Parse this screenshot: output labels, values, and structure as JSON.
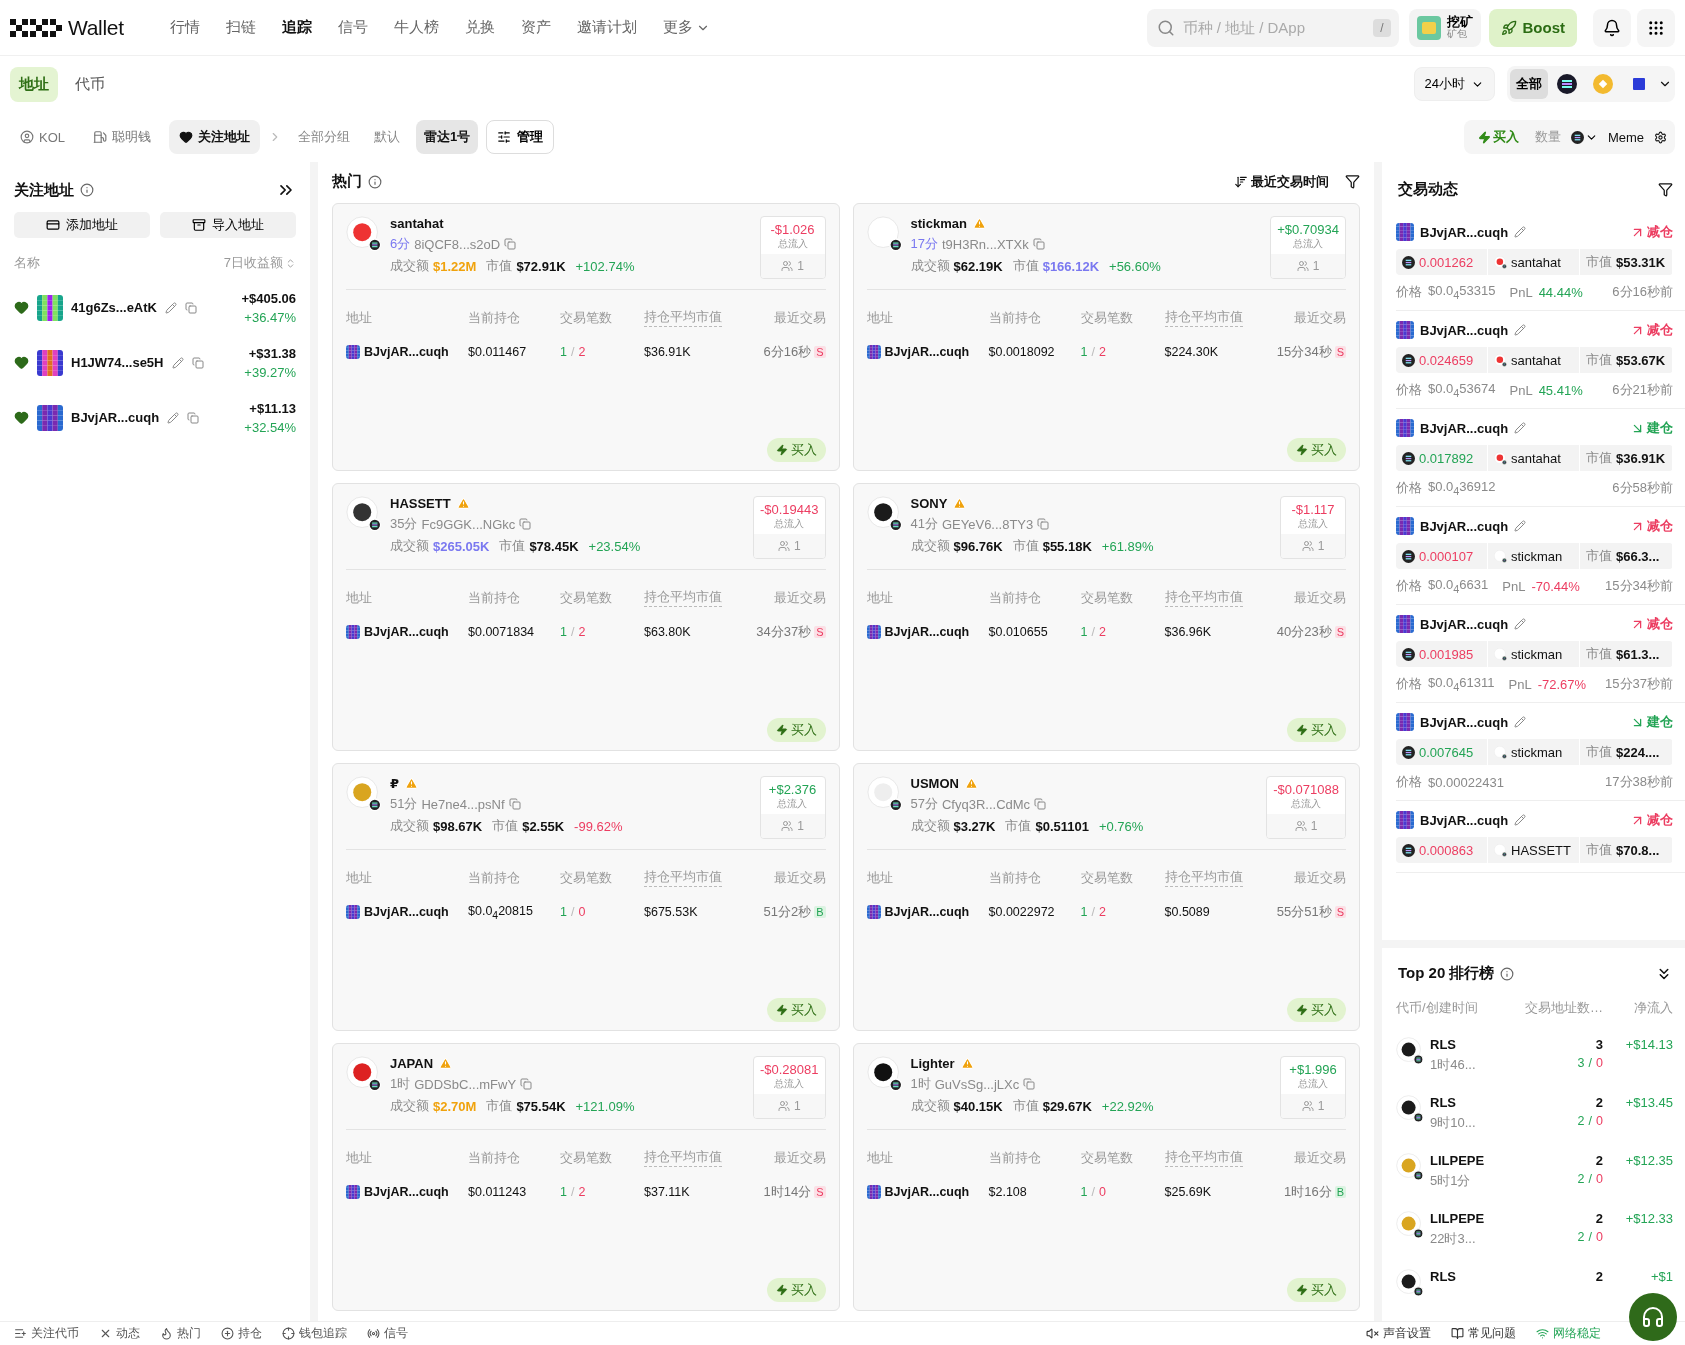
{
  "nav": {
    "brand": "Wallet",
    "items": [
      {
        "label": "行情",
        "selected": false
      },
      {
        "label": "扫链",
        "selected": false
      },
      {
        "label": "追踪",
        "selected": true
      },
      {
        "label": "信号",
        "selected": false
      },
      {
        "label": "牛人榜",
        "selected": false
      },
      {
        "label": "兑换",
        "selected": false
      },
      {
        "label": "资产",
        "selected": false
      },
      {
        "label": "邀请计划",
        "selected": false
      }
    ],
    "more": "更多",
    "search": {
      "placeholder": "币种 / 地址 / DApp",
      "shortcut": "/"
    },
    "mining": {
      "title": "挖矿",
      "subtitle": "矿包"
    },
    "boost": "Boost"
  },
  "scope_tabs": [
    {
      "label": "地址",
      "selected": true
    },
    {
      "label": "代币",
      "selected": false
    }
  ],
  "period": "24小时",
  "chains": [
    {
      "kind": "all",
      "label": "全部",
      "selected": true
    },
    {
      "kind": "solana",
      "selected": false
    },
    {
      "kind": "bnb",
      "selected": false
    },
    {
      "kind": "base",
      "selected": false
    }
  ],
  "categories": [
    {
      "kind": "kol",
      "label": "KOL",
      "selected": false
    },
    {
      "kind": "smart",
      "label": "聪明钱",
      "selected": false
    },
    {
      "kind": "watch",
      "label": "关注地址",
      "selected": true
    }
  ],
  "groups": [
    {
      "label": "全部分组",
      "selected": false
    },
    {
      "label": "默认",
      "selected": false
    },
    {
      "label": "雷达1号",
      "selected": true
    }
  ],
  "manage": "管理",
  "quick_buy": {
    "buy": "买入",
    "amount_label": "数量",
    "preset": "Meme"
  },
  "watchlist": {
    "title": "关注地址",
    "add": "添加地址",
    "import": "导入地址",
    "columns": [
      "名称",
      "7日收益额"
    ],
    "items": [
      {
        "name": "41g6Zs...eAtK",
        "favorite": true,
        "pnl": "+$405.06",
        "pct": "+36.47%"
      },
      {
        "name": "H1JW74...se5H",
        "favorite": true,
        "pnl": "+$31.38",
        "pct": "+39.27%"
      },
      {
        "name": "BJvjAR...cuqh",
        "favorite": true,
        "pnl": "+$11.13",
        "pct": "+32.54%"
      }
    ]
  },
  "hot": {
    "title": "热门",
    "sort": "最近交易时间",
    "cards": [
      {
        "name": "santahat",
        "warn": false,
        "age": {
          "text": "6分",
          "fresh": true
        },
        "address": "8iQCF8...s2oD",
        "volume_label": "成交额",
        "volume": {
          "text": "$1.22M",
          "color": "#f0a20c"
        },
        "mcap_label": "市值",
        "mcap": {
          "text": "$72.91K",
          "color": "#111111"
        },
        "change": {
          "text": "+102.74%",
          "positive": true
        },
        "inflow": {
          "text": "-$1.026",
          "positive": false
        },
        "inflow_label": "总流入",
        "holders": "1",
        "columns": [
          "地址",
          "当前持仓",
          "交易笔数",
          "持仓平均市值",
          "最近交易"
        ],
        "trades": [
          {
            "wallet": "BJvjAR...cuqh",
            "holding": "$0.011467",
            "buys": "1",
            "sep": "/",
            "sells": "2",
            "avg": "$36.91K",
            "time": "6分16秒",
            "side": {
              "label": "S",
              "kind": "sell"
            }
          }
        ],
        "buy": "买入"
      },
      {
        "name": "stickman",
        "warn": true,
        "age": {
          "text": "17分",
          "fresh": true
        },
        "address": "t9H3Rn...XTXk",
        "volume_label": "成交额",
        "volume": {
          "text": "$62.19K",
          "color": "#111111"
        },
        "mcap_label": "市值",
        "mcap": {
          "text": "$166.12K",
          "color": "#7a78f0"
        },
        "change": {
          "text": "+56.60%",
          "positive": true
        },
        "inflow": {
          "text": "+$0.70934",
          "positive": true
        },
        "inflow_label": "总流入",
        "holders": "1",
        "columns": [
          "地址",
          "当前持仓",
          "交易笔数",
          "持仓平均市值",
          "最近交易"
        ],
        "trades": [
          {
            "wallet": "BJvjAR...cuqh",
            "holding": "$0.0018092",
            "buys": "1",
            "sep": "/",
            "sells": "2",
            "avg": "$224.30K",
            "time": "15分34秒",
            "side": {
              "label": "S",
              "kind": "sell"
            }
          }
        ],
        "buy": "买入"
      },
      {
        "name": "HASSETT",
        "warn": true,
        "age": {
          "text": "35分",
          "fresh": false
        },
        "address": "Fc9GGK...NGkc",
        "volume_label": "成交额",
        "volume": {
          "text": "$265.05K",
          "color": "#7a78f0"
        },
        "mcap_label": "市值",
        "mcap": {
          "text": "$78.45K",
          "color": "#111111"
        },
        "change": {
          "text": "+23.54%",
          "positive": true
        },
        "inflow": {
          "text": "-$0.19443",
          "positive": false
        },
        "inflow_label": "总流入",
        "holders": "1",
        "columns": [
          "地址",
          "当前持仓",
          "交易笔数",
          "持仓平均市值",
          "最近交易"
        ],
        "trades": [
          {
            "wallet": "BJvjAR...cuqh",
            "holding": "$0.0071834",
            "buys": "1",
            "sep": "/",
            "sells": "2",
            "avg": "$63.80K",
            "time": "34分37秒",
            "side": {
              "label": "S",
              "kind": "sell"
            }
          }
        ],
        "buy": "买入"
      },
      {
        "name": "SONY",
        "warn": true,
        "age": {
          "text": "41分",
          "fresh": false
        },
        "address": "GEYeV6...8TY3",
        "volume_label": "成交额",
        "volume": {
          "text": "$96.76K",
          "color": "#111111"
        },
        "mcap_label": "市值",
        "mcap": {
          "text": "$55.18K",
          "color": "#111111"
        },
        "change": {
          "text": "+61.89%",
          "positive": true
        },
        "inflow": {
          "text": "-$1.117",
          "positive": false
        },
        "inflow_label": "总流入",
        "holders": "1",
        "columns": [
          "地址",
          "当前持仓",
          "交易笔数",
          "持仓平均市值",
          "最近交易"
        ],
        "trades": [
          {
            "wallet": "BJvjAR...cuqh",
            "holding": "$0.010655",
            "buys": "1",
            "sep": "/",
            "sells": "2",
            "avg": "$36.96K",
            "time": "40分23秒",
            "side": {
              "label": "S",
              "kind": "sell"
            }
          }
        ],
        "buy": "买入"
      },
      {
        "name": "₽",
        "warn": true,
        "age": {
          "text": "51分",
          "fresh": false
        },
        "address": "He7ne4...psNf",
        "volume_label": "成交额",
        "volume": {
          "text": "$98.67K",
          "color": "#111111"
        },
        "mcap_label": "市值",
        "mcap": {
          "text": "$2.55K",
          "color": "#111111"
        },
        "change": {
          "text": "-99.62%",
          "positive": false
        },
        "inflow": {
          "text": "+$2.376",
          "positive": true
        },
        "inflow_label": "总流入",
        "holders": "1",
        "columns": [
          "地址",
          "当前持仓",
          "交易笔数",
          "持仓平均市值",
          "最近交易"
        ],
        "trades": [
          {
            "wallet": "BJvjAR...cuqh",
            "holding": "$0.0$_{4}$20815",
            "buys": "1",
            "sep": "/",
            "sells": "0",
            "avg": "$675.53K",
            "time": "51分2秒",
            "side": {
              "label": "B",
              "kind": "buy"
            }
          }
        ],
        "buy": "买入"
      },
      {
        "name": "USMON",
        "warn": true,
        "age": {
          "text": "57分",
          "fresh": false
        },
        "address": "Cfyq3R...CdMc",
        "volume_label": "成交额",
        "volume": {
          "text": "$3.27K",
          "color": "#111111"
        },
        "mcap_label": "市值",
        "mcap": {
          "text": "$0.51101",
          "color": "#111111"
        },
        "change": {
          "text": "+0.76%",
          "positive": true
        },
        "inflow": {
          "text": "-$0.071088",
          "positive": false
        },
        "inflow_label": "总流入",
        "holders": "1",
        "columns": [
          "地址",
          "当前持仓",
          "交易笔数",
          "持仓平均市值",
          "最近交易"
        ],
        "trades": [
          {
            "wallet": "BJvjAR...cuqh",
            "holding": "$0.0022972",
            "buys": "1",
            "sep": "/",
            "sells": "2",
            "avg": "$0.5089",
            "time": "55分51秒",
            "side": {
              "label": "S",
              "kind": "sell"
            }
          }
        ],
        "buy": "买入"
      },
      {
        "name": "JAPAN",
        "warn": true,
        "age": {
          "text": "1时",
          "fresh": false
        },
        "address": "GDDSbC...mFwY",
        "volume_label": "成交额",
        "volume": {
          "text": "$2.70M",
          "color": "#f0a20c"
        },
        "mcap_label": "市值",
        "mcap": {
          "text": "$75.54K",
          "color": "#111111"
        },
        "change": {
          "text": "+121.09%",
          "positive": true
        },
        "inflow": {
          "text": "-$0.28081",
          "positive": false
        },
        "inflow_label": "总流入",
        "holders": "1",
        "columns": [
          "地址",
          "当前持仓",
          "交易笔数",
          "持仓平均市值",
          "最近交易"
        ],
        "trades": [
          {
            "wallet": "BJvjAR...cuqh",
            "holding": "$0.011243",
            "buys": "1",
            "sep": "/",
            "sells": "2",
            "avg": "$37.11K",
            "time": "1时14分",
            "side": {
              "label": "S",
              "kind": "sell"
            }
          }
        ],
        "buy": "买入"
      },
      {
        "name": "Lighter",
        "warn": true,
        "age": {
          "text": "1时",
          "fresh": false
        },
        "address": "GuVsSg...jLXc",
        "volume_label": "成交额",
        "volume": {
          "text": "$40.15K",
          "color": "#111111"
        },
        "mcap_label": "市值",
        "mcap": {
          "text": "$29.67K",
          "color": "#111111"
        },
        "change": {
          "text": "+22.92%",
          "positive": true
        },
        "inflow": {
          "text": "+$1.996",
          "positive": true
        },
        "inflow_label": "总流入",
        "holders": "1",
        "columns": [
          "地址",
          "当前持仓",
          "交易笔数",
          "持仓平均市值",
          "最近交易"
        ],
        "trades": [
          {
            "wallet": "BJvjAR...cuqh",
            "holding": "$2.108",
            "buys": "1",
            "sep": "/",
            "sells": "0",
            "avg": "$25.69K",
            "time": "1时16分",
            "side": {
              "label": "B",
              "kind": "buy"
            }
          }
        ],
        "buy": "买入"
      }
    ]
  },
  "feed": {
    "title": "交易动态",
    "items": [
      {
        "wallet": "BJvjAR...cuqh",
        "action": {
          "label": "减仓",
          "kind": "sell"
        },
        "amount": "0.001262",
        "token": "santahat",
        "mcap_label": "市值",
        "mcap": "$53.31K",
        "price_label": "价格",
        "price": "$0.0$_{4}$53315",
        "pnl_label": "PnL",
        "pnl": {
          "text": "44.44%",
          "positive": true
        },
        "time": "6分16秒前"
      },
      {
        "wallet": "BJvjAR...cuqh",
        "action": {
          "label": "减仓",
          "kind": "sell"
        },
        "amount": "0.024659",
        "token": "santahat",
        "mcap_label": "市值",
        "mcap": "$53.67K",
        "price_label": "价格",
        "price": "$0.0$_{4}$53674",
        "pnl_label": "PnL",
        "pnl": {
          "text": "45.41%",
          "positive": true
        },
        "time": "6分21秒前"
      },
      {
        "wallet": "BJvjAR...cuqh",
        "action": {
          "label": "建仓",
          "kind": "buy"
        },
        "amount": "0.017892",
        "token": "santahat",
        "mcap_label": "市值",
        "mcap": "$36.91K",
        "price_label": "价格",
        "price": "$0.0$_{4}$36912",
        "time": "6分58秒前"
      },
      {
        "wallet": "BJvjAR...cuqh",
        "action": {
          "label": "减仓",
          "kind": "sell"
        },
        "amount": "0.000107",
        "token": "stickman",
        "mcap_label": "市值",
        "mcap": "$66.3...",
        "price_label": "价格",
        "price": "$0.0$_{4}$6631",
        "pnl_label": "PnL",
        "pnl": {
          "text": "-70.44%",
          "positive": false
        },
        "time": "15分34秒前"
      },
      {
        "wallet": "BJvjAR...cuqh",
        "action": {
          "label": "减仓",
          "kind": "sell"
        },
        "amount": "0.001985",
        "token": "stickman",
        "mcap_label": "市值",
        "mcap": "$61.3...",
        "price_label": "价格",
        "price": "$0.0$_{4}$61311",
        "pnl_label": "PnL",
        "pnl": {
          "text": "-72.67%",
          "positive": false
        },
        "time": "15分37秒前"
      },
      {
        "wallet": "BJvjAR...cuqh",
        "action": {
          "label": "建仓",
          "kind": "buy"
        },
        "amount": "0.007645",
        "token": "stickman",
        "mcap_label": "市值",
        "mcap": "$224....",
        "price_label": "价格",
        "price": "$0.00022431",
        "time": "17分38秒前"
      },
      {
        "wallet": "BJvjAR...cuqh",
        "action": {
          "label": "减仓",
          "kind": "sell"
        },
        "amount": "0.000863",
        "token": "HASSETT",
        "mcap_label": "市值",
        "mcap": "$70.8..."
      }
    ]
  },
  "top20": {
    "title": "Top 20 排行榜",
    "columns": [
      "代币/创建时间",
      "交易地址数…",
      "净流入"
    ],
    "rows": [
      {
        "token": "RLS",
        "age": "1时46...",
        "count": "3",
        "buys": "3",
        "sep": "/",
        "sells": "0",
        "inflow": "+$14.13"
      },
      {
        "token": "RLS",
        "age": "9时10...",
        "count": "2",
        "buys": "2",
        "sep": "/",
        "sells": "0",
        "inflow": "+$13.45"
      },
      {
        "token": "LILPEPE",
        "age": "5时1分",
        "count": "2",
        "buys": "2",
        "sep": "/",
        "sells": "0",
        "inflow": "+$12.35"
      },
      {
        "token": "LILPEPE",
        "age": "22时3...",
        "count": "2",
        "buys": "2",
        "sep": "/",
        "sells": "0",
        "inflow": "+$12.33"
      },
      {
        "token": "RLS",
        "count": "2",
        "inflow": "+$1"
      }
    ]
  },
  "footer": {
    "left": [
      {
        "kind": "coins",
        "label": "关注代币"
      },
      {
        "kind": "x",
        "label": "动态"
      },
      {
        "kind": "fire",
        "label": "热门"
      },
      {
        "kind": "plus",
        "label": "持仓"
      },
      {
        "kind": "track",
        "label": "钱包追踪"
      },
      {
        "kind": "signal",
        "label": "信号"
      }
    ],
    "right": [
      {
        "kind": "mute",
        "label": "声音设置"
      },
      {
        "kind": "faq",
        "label": "常见问题"
      },
      {
        "kind": "net",
        "label": "网络稳定"
      }
    ]
  }
}
